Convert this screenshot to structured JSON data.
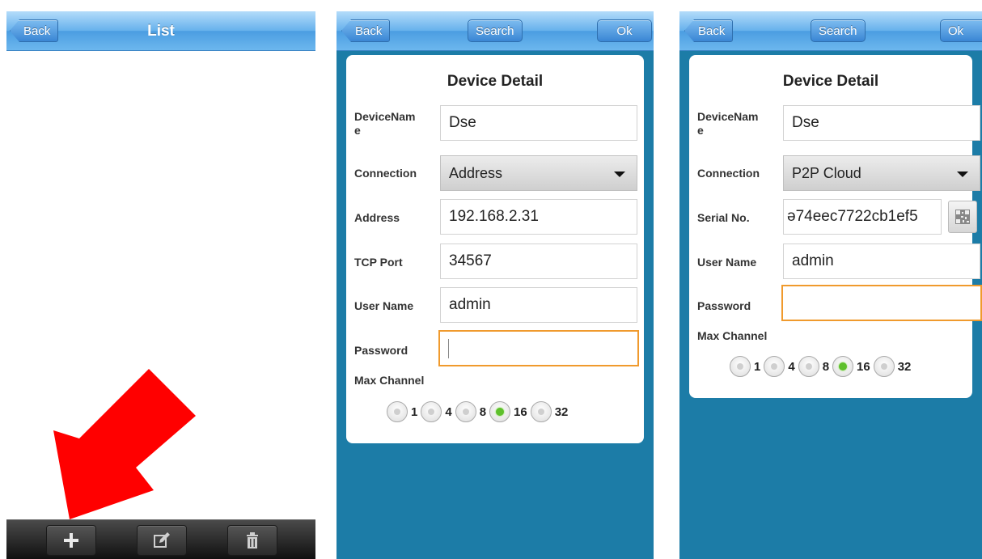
{
  "list_screen": {
    "back_label": "Back",
    "title": "List",
    "toolbar_icons": [
      "add-icon",
      "edit-icon",
      "trash-icon"
    ]
  },
  "detail_address": {
    "back_label": "Back",
    "search_label": "Search",
    "ok_label": "Ok",
    "card_title": "Device Detail",
    "device_name_label": "DeviceNam\ne",
    "device_name_value": "Dse",
    "connection_label": "Connection",
    "connection_value": "Address",
    "address_label": "Address",
    "address_value": "192.168.2.31",
    "tcp_port_label": "TCP Port",
    "tcp_port_value": "34567",
    "user_name_label": "User Name",
    "user_name_value": "admin",
    "password_label": "Password",
    "password_value": "",
    "max_channel_label": "Max Channel",
    "channels": [
      "1",
      "4",
      "8",
      "16",
      "32"
    ],
    "selected_channel": "16"
  },
  "detail_p2p": {
    "back_label": "Back",
    "search_label": "Search",
    "ok_label": "Ok",
    "card_title": "Device Detail",
    "device_name_label": "DeviceNam\ne",
    "device_name_value": "Dse",
    "connection_label": "Connection",
    "connection_value": "P2P Cloud",
    "serial_label": "Serial No.",
    "serial_value": "ə74eec7722cb1ef5",
    "user_name_label": "User Name",
    "user_name_value": "admin",
    "password_label": "Password",
    "password_value": "",
    "max_channel_label": "Max Channel",
    "channels": [
      "1",
      "4",
      "8",
      "16",
      "32"
    ],
    "selected_channel": "16"
  },
  "annotation": {
    "arrow_color": "#ff0000"
  },
  "colors": {
    "screen_bg": "#1c7ca7",
    "header_blue": "#4b9de1",
    "focus_orange": "#f09a2d",
    "radio_on": "#5ec02c"
  }
}
